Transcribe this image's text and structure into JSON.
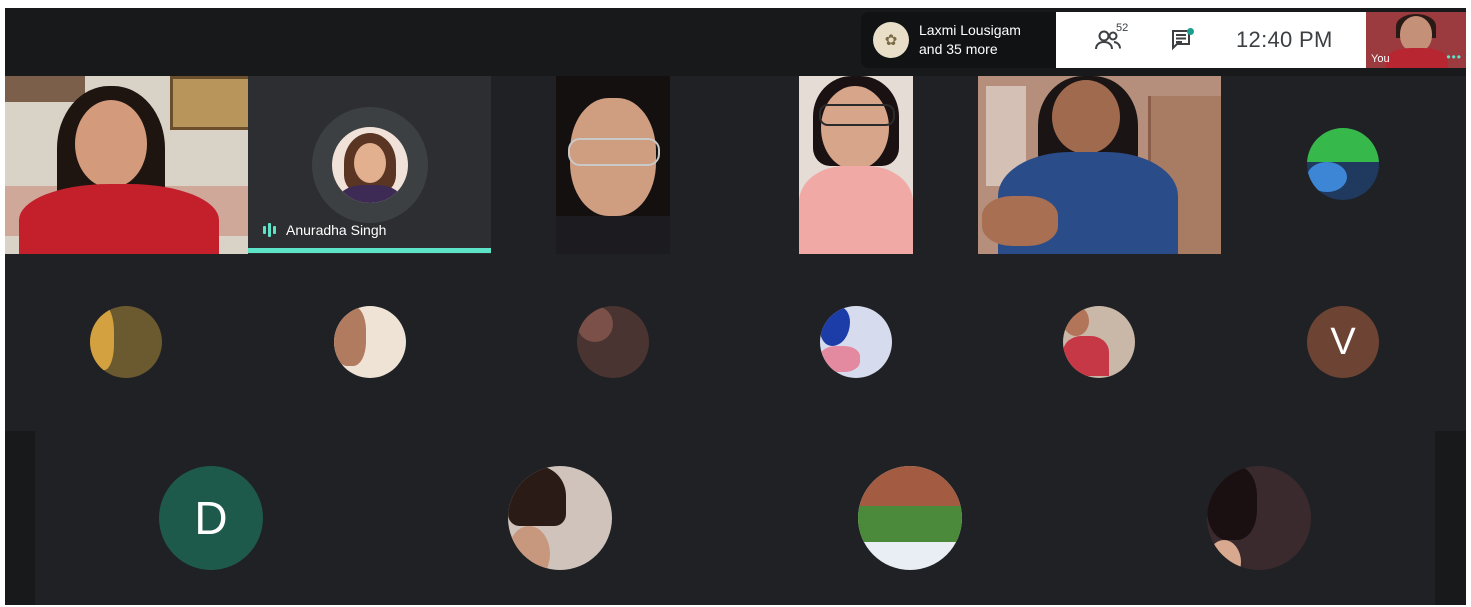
{
  "presenter": {
    "name": "Laxmi Lousigam",
    "more": "and 35 more"
  },
  "controls": {
    "people_count": "52",
    "time": "12:40 PM"
  },
  "self_view": {
    "label": "You"
  },
  "speaker": {
    "name": "Anuradha Singh"
  },
  "participants_letters": {
    "v": "V",
    "d": "D"
  },
  "colors": {
    "accent": "#5de3c8",
    "background": "#202124",
    "avatar_v": "#6d4434",
    "avatar_d": "#1e5a4b"
  }
}
